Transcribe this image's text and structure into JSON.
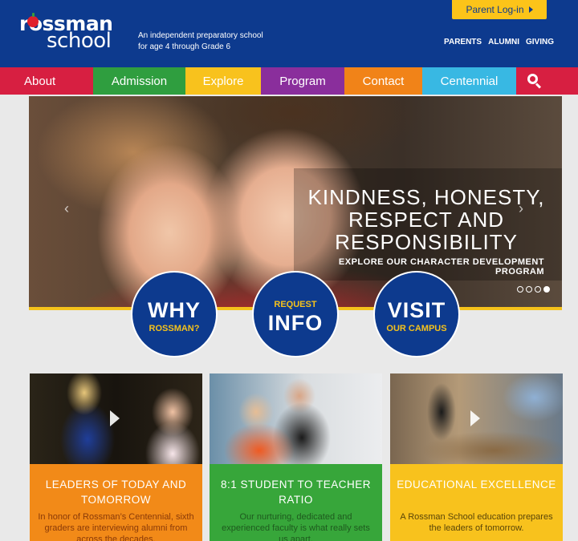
{
  "header": {
    "logo_top": "rossman",
    "logo_bottom": "school",
    "tagline": "An independent preparatory school for age 4 through Grade 6",
    "parent_login": "Parent Log-in",
    "util_links": [
      "PARENTS",
      "ALUMNI",
      "GIVING"
    ]
  },
  "nav": {
    "items": [
      "About",
      "Admission",
      "Explore",
      "Program",
      "Contact",
      "Centennial"
    ],
    "search_icon": "search-icon"
  },
  "hero": {
    "title": "KINDNESS, HONESTY, RESPECT AND RESPONSIBILITY",
    "subtitle": "EXPLORE OUR CHARACTER DEVELOPMENT PROGRAM",
    "prev": "‹",
    "next": "›",
    "slide_count": 4,
    "active_slide": 4
  },
  "circles": {
    "why": {
      "big": "WHY",
      "small": "ROSSMAN?"
    },
    "info": {
      "small": "REQUEST",
      "big": "INFO"
    },
    "visit": {
      "big": "VISIT",
      "small": "OUR CAMPUS"
    }
  },
  "cards": [
    {
      "title": "LEADERS OF TODAY AND TOMORROW",
      "text": "In honor of Rossman’s Centennial, sixth graders are interviewing alumni from across the decades."
    },
    {
      "title": "8:1 STUDENT TO TEACHER RATIO",
      "text": "Our nurturing, dedicated and experienced faculty is what really sets us apart."
    },
    {
      "title": "EDUCATIONAL EXCELLENCE",
      "text": "A Rossman School education prepares the leaders of tomorrow."
    }
  ],
  "colors": {
    "brand_blue": "#0d3a8e",
    "brand_yellow": "#f5c21b",
    "nav_red": "#d71f41",
    "nav_green": "#2f9e3f",
    "nav_yellow": "#f8c21d",
    "nav_purple": "#8a2e9c",
    "nav_orange": "#f18318",
    "nav_cyan": "#38b8e3"
  }
}
